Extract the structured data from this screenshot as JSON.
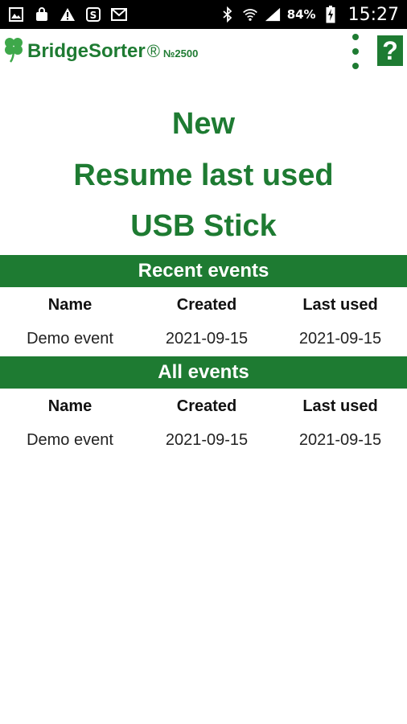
{
  "status_bar": {
    "battery_percent": "84%",
    "time": "15:27",
    "icons": [
      "image-icon",
      "shopping-bag-icon",
      "warning-icon",
      "skype-icon",
      "email-icon",
      "bluetooth-icon",
      "wifi-icon",
      "signal-icon",
      "battery-charging-icon"
    ]
  },
  "app_bar": {
    "title": "BridgeSorter",
    "registered_mark": "®",
    "model": "№2500",
    "help_label": "?"
  },
  "main_actions": {
    "new": "New",
    "resume": "Resume last used",
    "usb": "USB Stick"
  },
  "recent_events": {
    "header": "Recent events",
    "columns": [
      "Name",
      "Created",
      "Last used"
    ],
    "rows": [
      {
        "name": "Demo event",
        "created": "2021-09-15",
        "last_used": "2021-09-15"
      }
    ]
  },
  "all_events": {
    "header": "All events",
    "columns": [
      "Name",
      "Created",
      "Last used"
    ],
    "rows": [
      {
        "name": "Demo event",
        "created": "2021-09-15",
        "last_used": "2021-09-15"
      }
    ]
  },
  "colors": {
    "brand_green": "#1e7b32",
    "clover_green": "#3ea84a",
    "status_bar_bg": "#000000"
  }
}
